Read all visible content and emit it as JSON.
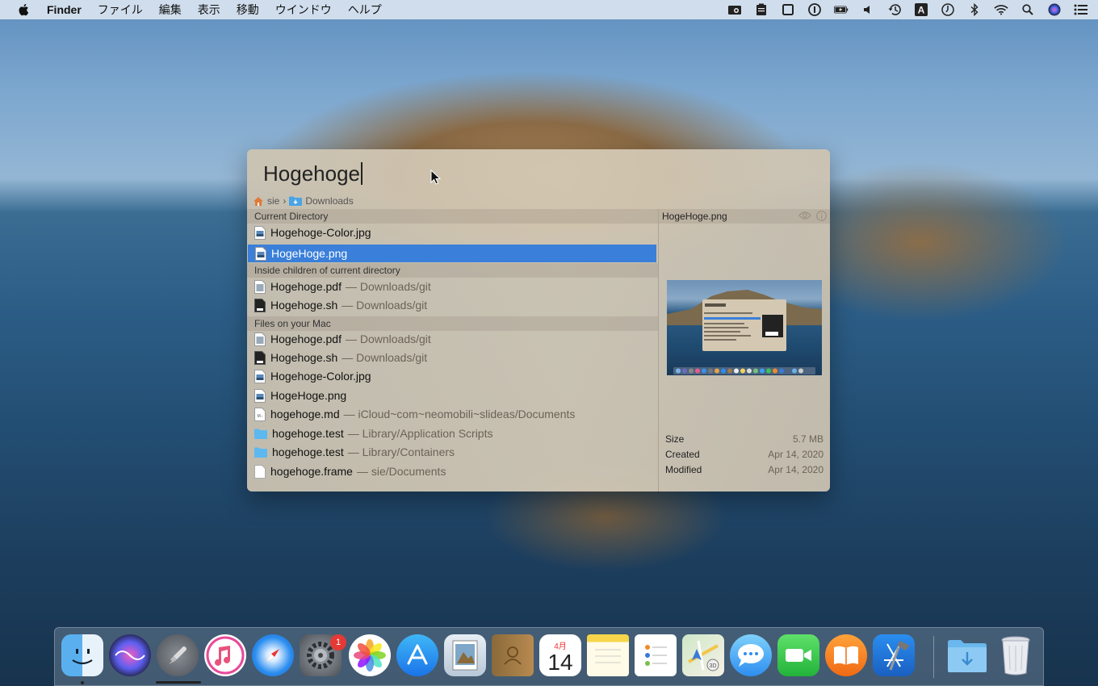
{
  "menubar": {
    "app_name": "Finder",
    "items": [
      "ファイル",
      "編集",
      "表示",
      "移動",
      "ウインドウ",
      "ヘルプ"
    ],
    "status_icons": [
      "screenshot-icon",
      "clipboard-icon",
      "window-icon",
      "onepassword-icon",
      "battery-charging-icon",
      "volume-icon",
      "time-machine-icon",
      "input-source-icon",
      "clock-icon",
      "bluetooth-icon",
      "wifi-icon",
      "spotlight-icon",
      "siri-icon",
      "notification-center-icon"
    ],
    "input_source_label": "A"
  },
  "launcher": {
    "query": "Hogehoge",
    "breadcrumb": {
      "home": "sie",
      "folder": "Downloads"
    },
    "sections": [
      {
        "title": "Current Directory",
        "items": [
          {
            "name": "Hogehoge-Color.jpg",
            "path": "",
            "icon": "image-file-icon"
          },
          {
            "name": "HogeHoge.png",
            "path": "",
            "icon": "image-file-icon",
            "selected": true
          }
        ]
      },
      {
        "title": "Inside children of current directory",
        "items": [
          {
            "name": "Hogehoge.pdf",
            "path": "— Downloads/git",
            "icon": "pdf-file-icon"
          },
          {
            "name": "Hogehoge.sh",
            "path": "— Downloads/git",
            "icon": "shell-script-icon"
          }
        ]
      },
      {
        "title": "Files on your Mac",
        "items": [
          {
            "name": "Hogehoge.pdf",
            "path": "— Downloads/git",
            "icon": "pdf-file-icon"
          },
          {
            "name": "Hogehoge.sh",
            "path": "— Downloads/git",
            "icon": "shell-script-icon"
          },
          {
            "name": "Hogehoge-Color.jpg",
            "path": "",
            "icon": "image-file-icon"
          },
          {
            "name": "HogeHoge.png",
            "path": "",
            "icon": "image-file-icon"
          },
          {
            "name": "hogehoge.md",
            "path": "— iCloud~com~neomobili~slideas/Documents",
            "icon": "markdown-file-icon"
          },
          {
            "name": "hogehoge.test",
            "path": "— Library/Application Scripts",
            "icon": "folder-icon"
          },
          {
            "name": "hogehoge.test",
            "path": "— Library/Containers",
            "icon": "folder-icon"
          },
          {
            "name": "hogehoge.frame",
            "path": "— sie/Documents",
            "icon": "blank-file-icon"
          }
        ]
      }
    ],
    "preview": {
      "filename": "HogeHoge.png",
      "size_label": "Size",
      "size": "5.7 MB",
      "created_label": "Created",
      "created": "Apr 14, 2020",
      "modified_label": "Modified",
      "modified": "Apr 14, 2020"
    }
  },
  "dock": {
    "apps": [
      "Finder",
      "Siri",
      "Launchpad",
      "iTunes",
      "Safari",
      "System Preferences",
      "Photos",
      "App Store",
      "Preview",
      "Contacts",
      "Calendar",
      "Notes",
      "Reminders",
      "Maps",
      "Messages",
      "FaceTime",
      "Books",
      "Xcode"
    ],
    "system_prefs_badge": "1",
    "calendar_month": "4月",
    "calendar_day": "14",
    "stacks": [
      "Downloads",
      "Trash"
    ]
  },
  "colors": {
    "selection": "#3a7fd9",
    "panel": "#d6cbb7"
  }
}
